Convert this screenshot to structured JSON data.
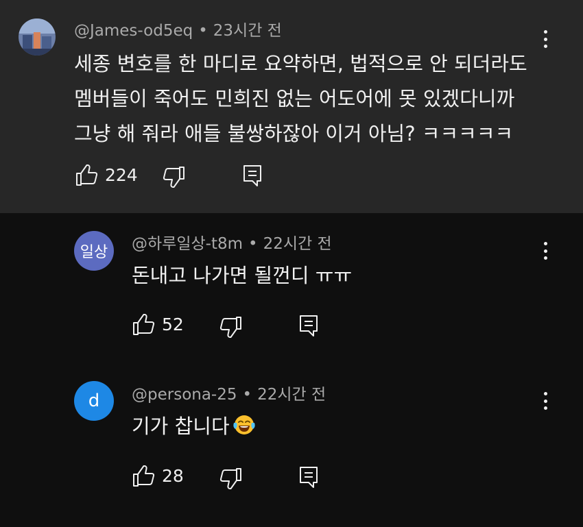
{
  "comments": [
    {
      "handle": "@James-od5eq",
      "time": "23시간 전",
      "lines": [
        "세종 변호를 한 마디로 요약하면, 법적으로 안 되더라도",
        "멤버들이 죽어도 민희진 없는 어도어에 못 있겠다니까",
        "그냥 해 줘라 애들 불쌍하잖아 이거 아님? ㅋㅋㅋㅋㅋ"
      ],
      "likes": "224",
      "avatar": {
        "type": "image",
        "colors": [
          "#5a6a8a",
          "#8fa3c4",
          "#c46a4a"
        ]
      }
    },
    {
      "handle": "@하루일상-t8m",
      "time": "22시간 전",
      "lines": [
        "돈내고 나가면 될껀디 ㅠㅠ"
      ],
      "likes": "52",
      "avatar": {
        "type": "text",
        "label": "일상",
        "color": "#5c6bc0"
      }
    },
    {
      "handle": "@persona-25",
      "time": "22시간 전",
      "lines": [
        "기가 찹니다"
      ],
      "emoji": "face-with-tears-of-joy",
      "likes": "28",
      "avatar": {
        "type": "text",
        "label": "d",
        "color": "#1e88e5"
      }
    }
  ],
  "separator": "•",
  "icons": {
    "like": "thumbs-up-icon",
    "dislike": "thumbs-down-icon",
    "reply": "reply-icon",
    "more": "kebab-menu-icon"
  }
}
